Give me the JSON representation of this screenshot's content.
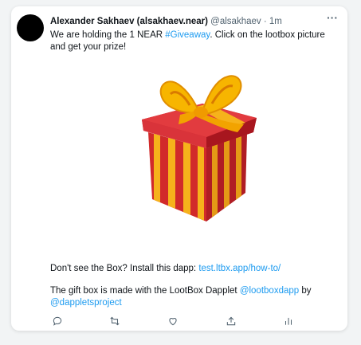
{
  "tweet": {
    "author_name": "Alexander Sakhaev (alsakhaev.near)",
    "handle": "@alsakhaev",
    "separator": "·",
    "time": "1m",
    "more_label": "···",
    "text_part1": "We are holding the 1 NEAR ",
    "hashtag": "#Giveaway",
    "text_part2": ". Click on the lootbox picture and get your prize!",
    "install_prefix": "Don't see the Box? Install this dapp: ",
    "install_link": "test.ltbx.app/how-to/",
    "credit_prefix": "The gift box is made with the LootBox Dapplet ",
    "credit_link1": "@lootboxdapp",
    "credit_by": " by",
    "credit_link2": "@dappletsproject"
  },
  "actions": {
    "reply": "reply-icon",
    "retweet": "retweet-icon",
    "like": "heart-icon",
    "share": "share-icon",
    "analytics": "analytics-icon"
  },
  "colors": {
    "link": "#1d9bf0",
    "text": "#0f1419",
    "muted": "#536471",
    "gift_red": "#c8102e",
    "gift_yellow": "#f7b500"
  }
}
